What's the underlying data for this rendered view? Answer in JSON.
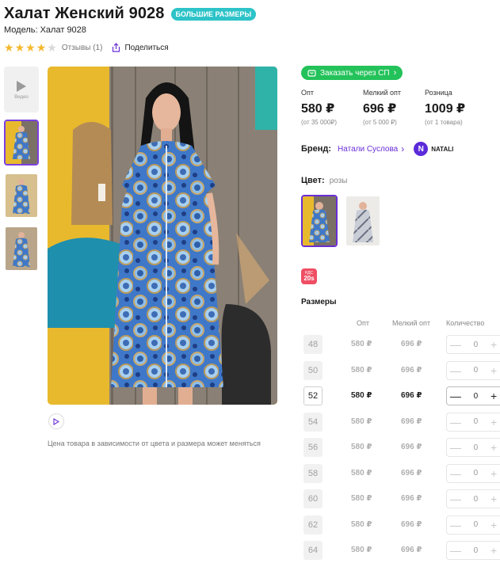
{
  "product": {
    "title": "Халат Женский 9028",
    "badge": "БОЛЬШИЕ РАЗМЕРЫ",
    "model": "Модель: Халат 9028",
    "rating": 4,
    "rating_max": 5,
    "reviews": "Отзывы (1)",
    "share": "Поделиться"
  },
  "gallery": {
    "video_label": "Видео",
    "note": "Цена товара в зависимости от цвета и размера может меняться"
  },
  "order_button": "Заказать через СП",
  "prices": [
    {
      "label": "Опт",
      "value": "580 ₽",
      "note": "(от 35 000₽)"
    },
    {
      "label": "Мелкий опт",
      "value": "696 ₽",
      "note": "(от 5 000 ₽)"
    },
    {
      "label": "Розница",
      "value": "1009 ₽",
      "note": "(от 1 товара)"
    }
  ],
  "brand": {
    "label": "Бренд:",
    "name": "Натали Суслова",
    "logo_letter": "N",
    "logo_text": "NATALI"
  },
  "color": {
    "label": "Цвет:",
    "value": "розы"
  },
  "vat": {
    "line1": "НДС",
    "line2": "20s"
  },
  "sizes": {
    "title": "Размеры",
    "headers": {
      "opt": "Опт",
      "small_opt": "Мелкий опт",
      "qty": "Количество"
    },
    "rows": [
      {
        "size": "48",
        "opt": "580 ₽",
        "small_opt": "696 ₽",
        "qty": "0",
        "selected": false
      },
      {
        "size": "50",
        "opt": "580 ₽",
        "small_opt": "696 ₽",
        "qty": "0",
        "selected": false
      },
      {
        "size": "52",
        "opt": "580 ₽",
        "small_opt": "696 ₽",
        "qty": "0",
        "selected": true
      },
      {
        "size": "54",
        "opt": "580 ₽",
        "small_opt": "696 ₽",
        "qty": "0",
        "selected": false
      },
      {
        "size": "56",
        "opt": "580 ₽",
        "small_opt": "696 ₽",
        "qty": "0",
        "selected": false
      },
      {
        "size": "58",
        "opt": "580 ₽",
        "small_opt": "696 ₽",
        "qty": "0",
        "selected": false
      },
      {
        "size": "60",
        "opt": "580 ₽",
        "small_opt": "696 ₽",
        "qty": "0",
        "selected": false
      },
      {
        "size": "62",
        "opt": "580 ₽",
        "small_opt": "696 ₽",
        "qty": "0",
        "selected": false
      },
      {
        "size": "64",
        "opt": "580 ₽",
        "small_opt": "696 ₽",
        "qty": "0",
        "selected": false
      }
    ]
  },
  "colors": {
    "accent": "#6a2ed6",
    "order_green": "#24c25a",
    "badge_teal": "#2dc3c8",
    "star": "#f5b82e",
    "vat_red": "#ef4e64"
  }
}
